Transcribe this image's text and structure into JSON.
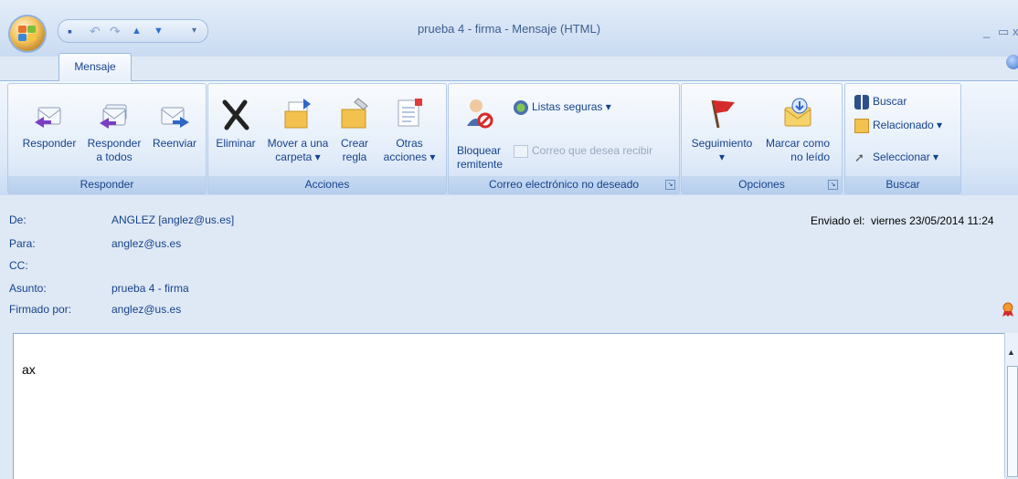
{
  "window": {
    "title": "prueba 4 - firma - Mensaje (HTML)"
  },
  "quick_access": [
    "save-icon",
    "undo-icon",
    "redo-icon",
    "up-arrow-icon",
    "down-arrow-icon",
    "customize-qat-icon"
  ],
  "tabs": [
    {
      "label": "Mensaje"
    }
  ],
  "groups": {
    "responder": {
      "label": "Responder",
      "buttons": {
        "reply": "Responder",
        "reply_all_1": "Responder",
        "reply_all_2": "a todos",
        "forward": "Reenviar"
      }
    },
    "acciones": {
      "label": "Acciones",
      "buttons": {
        "delete": "Eliminar",
        "move_1": "Mover a una",
        "move_2": "carpeta ▾",
        "rule_1": "Crear",
        "rule_2": "regla",
        "other_1": "Otras",
        "other_2": "acciones ▾"
      }
    },
    "junk": {
      "label": "Correo electrónico no deseado",
      "buttons": {
        "block_1": "Bloquear",
        "block_2": "remitente",
        "safe_lists": "Listas seguras ▾",
        "wanted_mail": "Correo que desea recibir"
      }
    },
    "opciones": {
      "label": "Opciones",
      "buttons": {
        "followup": "Seguimiento",
        "followup_arrow": "▾",
        "mark_1": "Marcar como",
        "mark_2": "no leído"
      }
    },
    "buscar": {
      "label": "Buscar",
      "buttons": {
        "find": "Buscar",
        "related": "Relacionado ▾",
        "select": "Seleccionar ▾"
      }
    }
  },
  "message": {
    "labels": {
      "from": "De:",
      "to": "Para:",
      "cc": "CC:",
      "subject": "Asunto:",
      "signed": "Firmado por:"
    },
    "from": "ANGLEZ [anglez@us.es]",
    "to": "anglez@us.es",
    "cc": "",
    "subject": "prueba 4 - firma",
    "signed_by": "anglez@us.es",
    "sent_label": "Enviado el:",
    "sent_value": "viernes 23/05/2014 11:24",
    "body": "ax"
  },
  "colors": {
    "ribbon": "#dde9f8",
    "text": "#15428b",
    "flag": "#d42b2b"
  }
}
